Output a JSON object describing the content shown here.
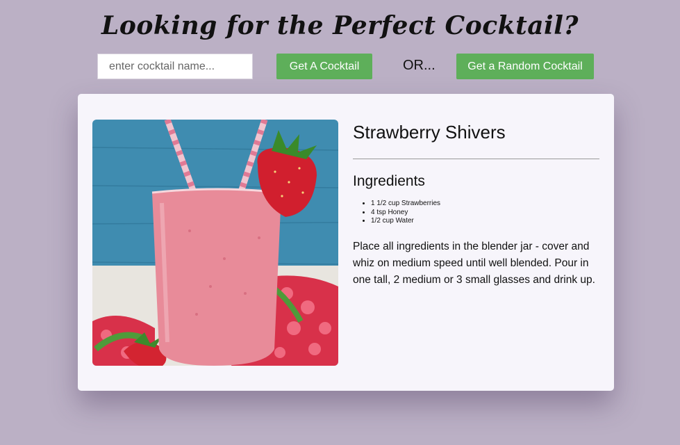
{
  "header": {
    "title": "Looking for the Perfect Cocktail?"
  },
  "search": {
    "placeholder": "enter cocktail name...",
    "value": "",
    "get_button_label": "Get A Cocktail",
    "or_text": "OR...",
    "random_button_label": "Get a Random Cocktail"
  },
  "cocktail": {
    "name": "Strawberry Shivers",
    "ingredients_heading": "Ingredients",
    "ingredients": [
      "1 1/2 cup Strawberries",
      "4 tsp Honey",
      "1/2 cup Water"
    ],
    "instructions": "Place all ingredients in the blender jar - cover and whiz on medium speed until well blended. Pour in one tall, 2 medium or 3 small glasses and drink up.",
    "image_icon": "strawberry-smoothie-photo"
  },
  "colors": {
    "background": "#bbb0c5",
    "button": "#5eaf5a",
    "card": "#f7f5fb"
  }
}
